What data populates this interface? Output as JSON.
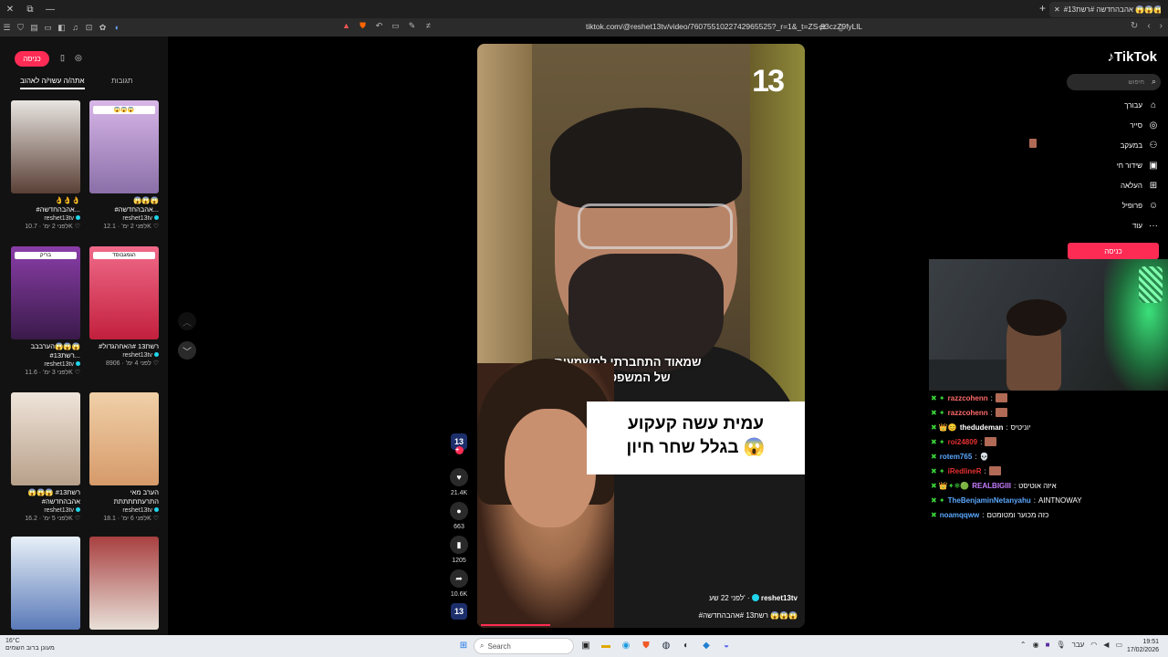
{
  "browser": {
    "tab_title": "#אהבהחדשה #רשת13 😱😱😱",
    "url": "tiktok.com/@reshet13tv/video/7607551022742965525?_r=1&_t=ZS-93czZ9fyLlL"
  },
  "left_panel": {
    "login_label": "כניסה",
    "tabs": [
      {
        "label": "אתה/ה עשוי/ה לאהוב",
        "active": true
      },
      {
        "label": "תגובות",
        "active": false
      }
    ],
    "cards": [
      {
        "title": "#אהבהחדשה...",
        "emoji": "😱😱😱",
        "author": "reshet13tv",
        "views": "12.1K",
        "age": "לפני 2 ימ'",
        "colors": [
          "#d8b6e8",
          "#8a6fa8"
        ],
        "thumb_text": "😱😱😱"
      },
      {
        "title": "#אהבהחדשה...",
        "emoji": "👌👌👌",
        "author": "reshet13tv",
        "views": "10.7K",
        "age": "לפני 2 ימ'",
        "colors": [
          "#e8e4e0",
          "#5a4036"
        ],
        "thumb_text": ""
      },
      {
        "title": "#רשת13 #האחהגדול",
        "emoji": "",
        "author": "reshet13tv",
        "views": "8906",
        "age": "לפני 4 ימ'",
        "colors": [
          "#f06a8a",
          "#c2203c"
        ],
        "thumb_text": "הגמגבוסד"
      },
      {
        "title": "#רשת13...",
        "emoji": "הערבבב😱😱😱",
        "author": "reshet13tv",
        "views": "11.6K",
        "age": "לפני 3 ימ'",
        "colors": [
          "#8a3ea8",
          "#3a1a4a"
        ],
        "thumb_text": "בריק"
      },
      {
        "title": "התרעתתתתתת",
        "emoji": "הערב מאי",
        "author": "reshet13tv",
        "views": "18.1K",
        "age": "לפני 6 ימ'",
        "colors": [
          "#f0d0a8",
          "#d69a6a"
        ],
        "thumb_text": ""
      },
      {
        "title": "#אהבהחדשה",
        "emoji": "😱😱😱 #רשת13",
        "author": "reshet13tv",
        "views": "16.2K",
        "age": "לפני 5 ימ'",
        "colors": [
          "#efe4da",
          "#b8a08a"
        ],
        "thumb_text": ""
      },
      {
        "title": "",
        "emoji": "",
        "author": "",
        "views": "",
        "age": "",
        "colors": [
          "#a84040",
          "#e8e0d8"
        ],
        "thumb_text": ""
      },
      {
        "title": "",
        "emoji": "",
        "author": "",
        "views": "",
        "age": "",
        "colors": [
          "#e8f0f8",
          "#5a7ab8"
        ],
        "thumb_text": ""
      }
    ]
  },
  "video": {
    "logo": "13",
    "subtitle_line1": "שמאוד התחברתי למשמעות",
    "subtitle_line2": "של המשפט הזה",
    "headline_line1": "עמית עשה קעקוע",
    "headline_line2": "בגלל שחר חיון 😱",
    "author": "reshet13tv",
    "posted": "לפני 22 שע'",
    "caption": "#רשת13 #אהבהחדשה 😱😱😱"
  },
  "actions": {
    "likes": "21.4K",
    "comments": "663",
    "saves": "1205",
    "shares": "10.6K"
  },
  "right_nav": {
    "logo": "TikTok",
    "search_placeholder": "חיפוש",
    "items": [
      {
        "label": "עבורך",
        "icon": "home-icon",
        "glyph": "⌂"
      },
      {
        "label": "סייר",
        "icon": "compass-icon",
        "glyph": "◎"
      },
      {
        "label": "במעקב",
        "icon": "following-icon",
        "glyph": "⚇"
      },
      {
        "label": "שידור חי",
        "icon": "live-icon",
        "glyph": "▣"
      },
      {
        "label": "העלאה",
        "icon": "upload-icon",
        "glyph": "⊞"
      },
      {
        "label": "פרופיל",
        "icon": "profile-icon",
        "glyph": "☺"
      },
      {
        "label": "עוד",
        "icon": "more-icon",
        "glyph": "···"
      }
    ],
    "login_button": "כניסה"
  },
  "chat": [
    {
      "user": "razzcohenn",
      "color": "#ff6a6a",
      "text": "",
      "emote": true,
      "badges": "✖ ✦"
    },
    {
      "user": "razzcohenn",
      "color": "#ff6a6a",
      "text": "",
      "emote": true,
      "badges": "✖ ✦"
    },
    {
      "user": "thedudeman",
      "color": "#ffffff",
      "text": "יוניטיס",
      "emote": false,
      "badges": "✖ 👑😊"
    },
    {
      "user": "roi24809",
      "color": "#e83030",
      "text": "",
      "emote": true,
      "badges": "✖ ✦"
    },
    {
      "user": "rotem765",
      "color": "#5aa8ff",
      "text": "💀",
      "emote": false,
      "badges": "✖"
    },
    {
      "user": "iRedlineR",
      "color": "#e83030",
      "text": "",
      "emote": true,
      "badges": "✖ ✦"
    },
    {
      "user": "REALBIGIII",
      "color": "#c77dff",
      "text": "איזה אוטיסט",
      "emote": false,
      "badges": "✖ 👑✦❄🟢"
    },
    {
      "user": "TheBenjaminNetanyahu",
      "color": "#5aa8ff",
      "text": "AINTNOWAY",
      "emote": false,
      "badges": "✖ ✦"
    },
    {
      "user": "noamqqww",
      "color": "#5aa8ff",
      "text": "כזה מכוער ומטומטם",
      "emote": false,
      "badges": "✖"
    }
  ],
  "taskbar": {
    "weather_line1": "16°C",
    "weather_line2": "מעונן ברוב השמים",
    "search_label": "Search",
    "lang": "עבר",
    "time": "19:51",
    "date": "17/02/2026"
  }
}
